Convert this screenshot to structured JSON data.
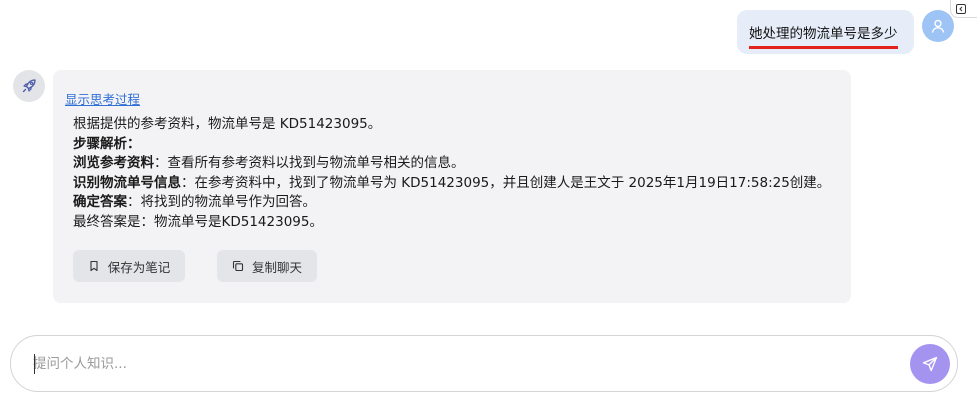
{
  "user_message": {
    "text": "她处理的物流单号是多少",
    "avatar_icon": "user-icon"
  },
  "bot_message": {
    "avatar_icon": "rocket-icon",
    "show_thinking_label": "显示思考过程",
    "lines": [
      {
        "bold": "",
        "text": "根据提供的参考资料，物流单号是 KD51423095。"
      },
      {
        "bold": "步骤解析：",
        "text": ""
      },
      {
        "bold": "浏览参考资料",
        "text": "：查看所有参考资料以找到与物流单号相关的信息。"
      },
      {
        "bold": "识别物流单号信息",
        "text": "：在参考资料中，找到了物流单号为 KD51423095，并且创建人是王文于 2025年1月19日17:58:25创建。"
      },
      {
        "bold": "确定答案",
        "text": "：将找到的物流单号作为回答。"
      },
      {
        "bold": "",
        "text": "最终答案是：物流单号是KD51423095。"
      }
    ],
    "actions": {
      "save_note_label": "保存为笔记",
      "copy_chat_label": "复制聊天"
    }
  },
  "input": {
    "placeholder": "提问个人知识...",
    "value": ""
  },
  "colors": {
    "user_bubble": "#e6edf9",
    "underline": "#e3231b",
    "bot_card": "#f3f3f5",
    "link": "#2f6fd6",
    "send_button": "#a593f0"
  }
}
